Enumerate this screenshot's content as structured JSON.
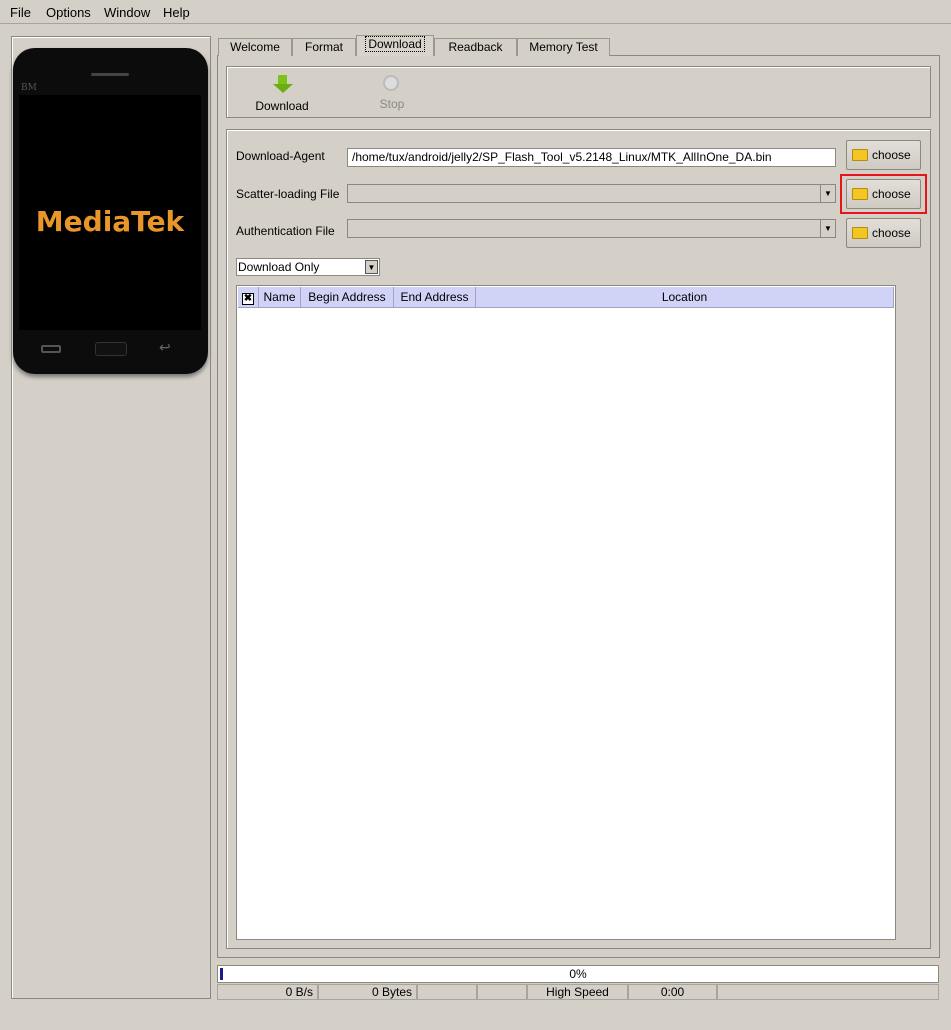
{
  "menu": {
    "items": [
      "File",
      "Options",
      "Window",
      "Help"
    ]
  },
  "phone": {
    "brand": "MediaTek",
    "badge": "BM"
  },
  "tabs": [
    "Welcome",
    "Format",
    "Download",
    "Readback",
    "Memory Test"
  ],
  "active_tab": "Download",
  "toolbar": {
    "download": "Download",
    "stop": "Stop"
  },
  "form": {
    "download_agent_label": "Download-Agent",
    "download_agent_value": "/home/tux/android/jelly2/SP_Flash_Tool_v5.2148_Linux/MTK_AllInOne_DA.bin",
    "scatter_label": "Scatter-loading File",
    "scatter_value": "",
    "auth_label": "Authentication File",
    "auth_value": "",
    "choose": "choose",
    "mode": "Download Only"
  },
  "table": {
    "columns": [
      "Name",
      "Begin Address",
      "End Address",
      "Location"
    ],
    "rows": []
  },
  "status": {
    "progress_text": "0%",
    "progress": 0,
    "speed": "0 B/s",
    "bytes": "0 Bytes",
    "usb_mode": "High Speed",
    "time": "0:00"
  },
  "colors": {
    "highlight": "#e8141c",
    "header": "#d0d2f6",
    "brand": "#e8962a"
  }
}
